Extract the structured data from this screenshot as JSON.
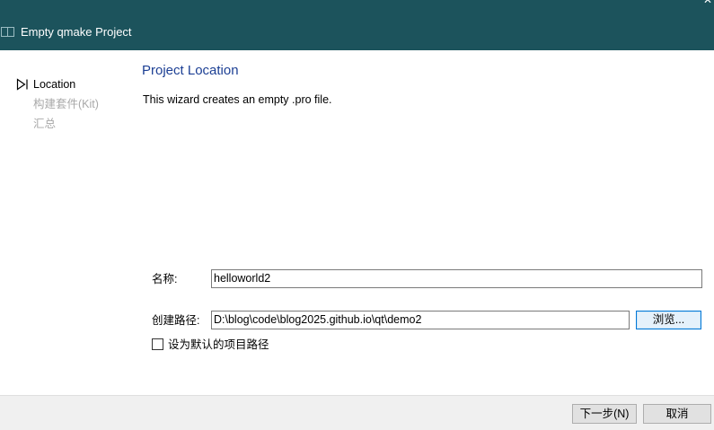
{
  "window": {
    "title": "Empty qmake Project",
    "close_glyph": "✕"
  },
  "sidebar": {
    "steps": [
      {
        "label": "Location",
        "state": "current"
      },
      {
        "label": "构建套件(Kit)",
        "state": "disabled"
      },
      {
        "label": "汇总",
        "state": "disabled"
      }
    ]
  },
  "main": {
    "title": "Project Location",
    "description": "This wizard creates an empty .pro file.",
    "name_label": "名称:",
    "name_value": "helloworld2",
    "path_label": "创建路径:",
    "path_value": "D:\\blog\\code\\blog2025.github.io\\qt\\demo2",
    "browse_label": "浏览...",
    "default_path_label": "设为默认的项目路径",
    "default_path_checked": false
  },
  "footer": {
    "next_label": "下一步(N)",
    "cancel_label": "取消"
  },
  "colors": {
    "titlebar": "#1c535c",
    "page_title": "#1c3f94",
    "disabled_text": "#a8a8a8",
    "footer_bg": "#f0f0f0"
  },
  "icons": {
    "window_icon": "window-icon",
    "step_marker": "current-step-triangle-icon",
    "close": "close-icon"
  }
}
